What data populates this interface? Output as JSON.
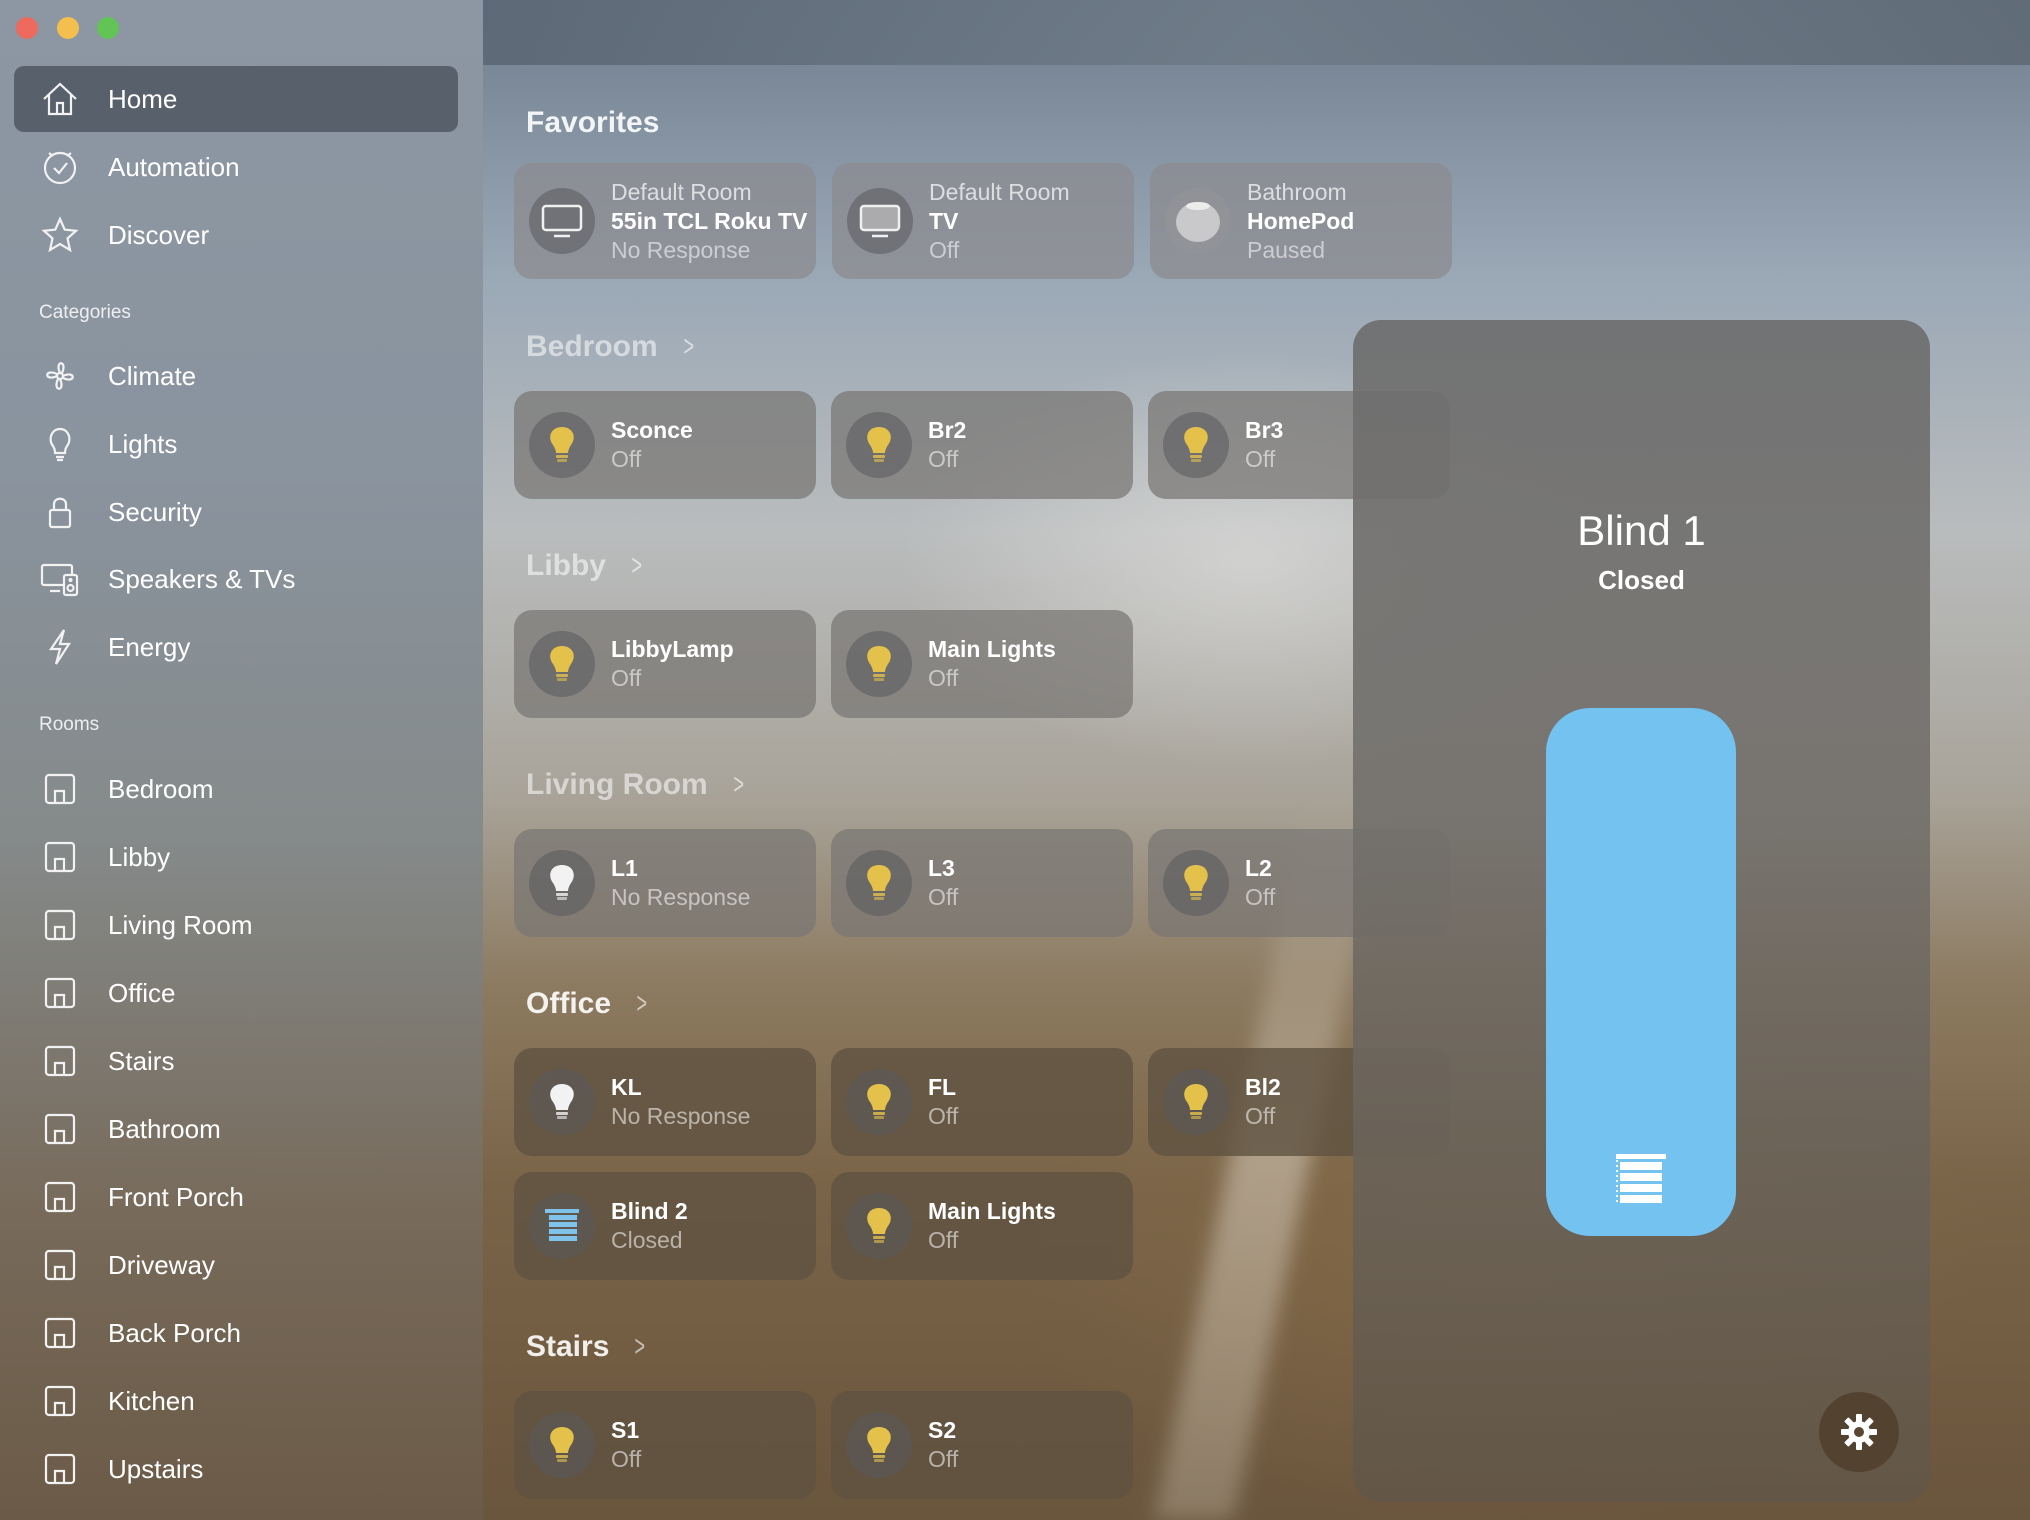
{
  "window": {
    "buttons": [
      "close",
      "minimize",
      "zoom"
    ]
  },
  "sidebar": {
    "main": [
      {
        "label": "Home",
        "icon": "home-icon",
        "active": true
      },
      {
        "label": "Automation",
        "icon": "clock-icon"
      },
      {
        "label": "Discover",
        "icon": "star-icon"
      }
    ],
    "categories_label": "Categories",
    "categories": [
      {
        "label": "Climate",
        "icon": "fan-icon"
      },
      {
        "label": "Lights",
        "icon": "lightbulb-icon"
      },
      {
        "label": "Security",
        "icon": "lock-icon"
      },
      {
        "label": "Speakers & TVs",
        "icon": "speaker-tv-icon"
      },
      {
        "label": "Energy",
        "icon": "bolt-icon"
      }
    ],
    "rooms_label": "Rooms",
    "rooms": [
      {
        "label": "Bedroom"
      },
      {
        "label": "Libby"
      },
      {
        "label": "Living Room"
      },
      {
        "label": "Office"
      },
      {
        "label": "Stairs"
      },
      {
        "label": "Bathroom"
      },
      {
        "label": "Front Porch"
      },
      {
        "label": "Driveway"
      },
      {
        "label": "Back Porch"
      },
      {
        "label": "Kitchen"
      },
      {
        "label": "Upstairs"
      }
    ]
  },
  "favorites": {
    "title": "Favorites",
    "tiles": [
      {
        "room": "Default Room",
        "name": "55in TCL Roku TV",
        "status": "No Response",
        "icon": "tv-icon"
      },
      {
        "room": "Default Room",
        "name": "TV",
        "status": "Off",
        "icon": "tv-icon"
      },
      {
        "room": "Bathroom",
        "name": "HomePod",
        "status": "Paused",
        "icon": "homepod-icon"
      }
    ]
  },
  "bedroom": {
    "title": "Bedroom",
    "chevron": ">",
    "tiles": [
      {
        "name": "Sconce",
        "status": "Off"
      },
      {
        "name": "Br2",
        "status": "Off"
      },
      {
        "name": "Br3",
        "status": "Off"
      }
    ]
  },
  "libby": {
    "title": "Libby",
    "chevron": ">",
    "tiles": [
      {
        "name": "LibbyLamp",
        "status": "Off"
      },
      {
        "name": "Main Lights",
        "status": "Off"
      }
    ]
  },
  "living_room": {
    "title": "Living Room",
    "chevron": ">",
    "tiles": [
      {
        "name": "L1",
        "status": "No Response"
      },
      {
        "name": "L3",
        "status": "Off"
      },
      {
        "name": "L2",
        "status": "Off"
      }
    ]
  },
  "office": {
    "title": "Office",
    "chevron": ">",
    "tiles": [
      {
        "name": "KL",
        "status": "No Response"
      },
      {
        "name": "FL",
        "status": "Off"
      },
      {
        "name": "Bl2",
        "status": "Off"
      },
      {
        "name": "Blind 2",
        "status": "Closed"
      },
      {
        "name": "Main Lights",
        "status": "Off"
      }
    ]
  },
  "stairs": {
    "title": "Stairs",
    "chevron": ">",
    "tiles": [
      {
        "name": "S1",
        "status": "Off"
      },
      {
        "name": "S2",
        "status": "Off"
      }
    ]
  },
  "detail": {
    "name": "Blind 1",
    "status": "Closed",
    "position_fraction": 0.0,
    "slider_color": "#73c2ef"
  },
  "colors": {
    "bulb_yellow": "#e3c14a",
    "bulb_white": "#f2f2f2"
  }
}
